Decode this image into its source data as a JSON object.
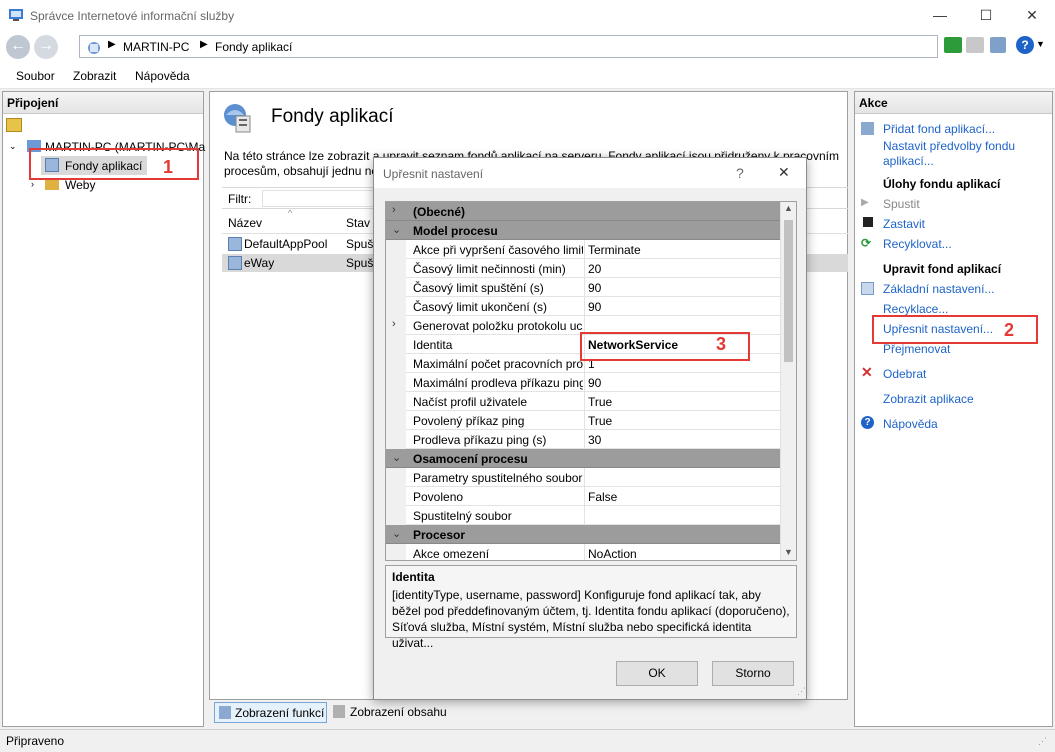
{
  "window": {
    "title": "Správce Internetové informační služby",
    "minimize": "—",
    "maximize": "☐",
    "close": "✕"
  },
  "address": {
    "seg1": "MARTIN-PC",
    "seg2": "Fondy aplikací"
  },
  "menu": [
    "Soubor",
    "Zobrazit",
    "Nápověda"
  ],
  "connections": {
    "header": "Připojení",
    "server": "MARTIN-PC (MARTIN-PC\\Ma",
    "pools": "Fondy aplikací",
    "sites": "Weby"
  },
  "center": {
    "title": "Fondy aplikací",
    "desc1": "Na této stránce lze zobrazit a upravit seznam fondů aplikací na serveru. Fondy aplikací jsou přidruženy k pracovním",
    "desc2": "procesům, obsahují jednu ne",
    "filter": "Filtr:",
    "col_name": "Název",
    "col_state": "Stav",
    "rows": [
      {
        "name": "DefaultAppPool",
        "state": "Spuš"
      },
      {
        "name": "eWay",
        "state": "Spuš"
      }
    ]
  },
  "tabs": {
    "features": "Zobrazení funkcí",
    "content": "Zobrazení obsahu"
  },
  "status": "Připraveno",
  "actions": {
    "header": "Akce",
    "add": "Přidat fond aplikací...",
    "defaults": "Nastavit předvolby fondu aplikací...",
    "tasks_header": "Úlohy fondu aplikací",
    "start": "Spustit",
    "stop": "Zastavit",
    "recycle": "Recyklovat...",
    "edit_header": "Upravit fond aplikací",
    "basic": "Základní nastavení...",
    "recycling": "Recyklace...",
    "advanced": "Upřesnit nastavení...",
    "rename": "Přejmenovat",
    "remove": "Odebrat",
    "view_apps": "Zobrazit aplikace",
    "help": "Nápověda"
  },
  "dialog": {
    "title": "Upřesnit nastavení",
    "help": "?",
    "close": "✕",
    "rows": [
      {
        "type": "cat",
        "name": "(Obecné)",
        "exp": "›"
      },
      {
        "type": "cat",
        "name": "Model procesu",
        "exp": "⌄"
      },
      {
        "name": "Akce při vypršení časového limit",
        "value": "Terminate"
      },
      {
        "name": "Časový limit nečinnosti (min)",
        "value": "20"
      },
      {
        "name": "Časový limit spuštění (s)",
        "value": "90"
      },
      {
        "name": "Časový limit ukončení (s)",
        "value": "90"
      },
      {
        "name": "Generovat položku protokolu uc",
        "value": "",
        "exp": "›"
      },
      {
        "name": "Identita",
        "value": "NetworkService",
        "bold": true
      },
      {
        "name": "Maximální počet pracovních pro",
        "value": "1"
      },
      {
        "name": "Maximální prodleva příkazu ping",
        "value": "90"
      },
      {
        "name": "Načíst profil uživatele",
        "value": "True"
      },
      {
        "name": "Povolený příkaz ping",
        "value": "True"
      },
      {
        "name": "Prodleva příkazu ping (s)",
        "value": "30"
      },
      {
        "type": "cat",
        "name": "Osamocení procesu",
        "exp": "⌄"
      },
      {
        "name": "Parametry spustitelného soubor",
        "value": ""
      },
      {
        "name": "Povoleno",
        "value": "False"
      },
      {
        "name": "Spustitelný soubor",
        "value": ""
      },
      {
        "type": "cat",
        "name": "Procesor",
        "exp": "⌄"
      },
      {
        "name": "Akce omezení",
        "value": "NoAction"
      }
    ],
    "desc_title": "Identita",
    "desc_text": "[identityType, username, password] Konfiguruje fond aplikací tak, aby běžel pod předdefinovaným účtem, tj. Identita fondu aplikací (doporučeno), Síťová služba, Místní systém, Místní služba nebo specifická identita uživat...",
    "ok": "OK",
    "cancel": "Storno"
  },
  "annotations": {
    "n1": "1",
    "n2": "2",
    "n3": "3"
  },
  "colors": {
    "accent": "#1e64c8",
    "annotation": "#e53935",
    "category": "#9c9c9c"
  }
}
